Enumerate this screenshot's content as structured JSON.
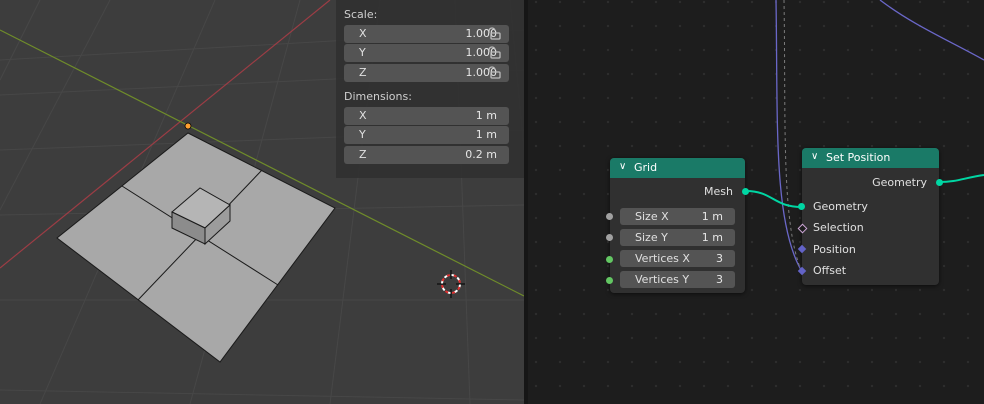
{
  "viewport": {
    "n_panel": {
      "scale_label": "Scale:",
      "scale": [
        {
          "axis": "X",
          "value": "1.000"
        },
        {
          "axis": "Y",
          "value": "1.000"
        },
        {
          "axis": "Z",
          "value": "1.000"
        }
      ],
      "dimensions_label": "Dimensions:",
      "dimensions": [
        {
          "axis": "X",
          "value": "1 m"
        },
        {
          "axis": "Y",
          "value": "1 m"
        },
        {
          "axis": "Z",
          "value": "0.2 m"
        }
      ]
    },
    "colors": {
      "background": "#3d3d3d",
      "x_axis": "#9c3d45",
      "y_axis": "#6f8c2a",
      "mesh": "#a8a8a8"
    }
  },
  "node_editor": {
    "grid_node": {
      "title": "Grid",
      "output": "Mesh",
      "inputs": [
        {
          "label": "Size X",
          "value": "1 m"
        },
        {
          "label": "Size Y",
          "value": "1 m"
        },
        {
          "label": "Vertices X",
          "value": "3"
        },
        {
          "label": "Vertices Y",
          "value": "3"
        }
      ]
    },
    "set_position_node": {
      "title": "Set Position",
      "output": "Geometry",
      "inputs": [
        "Geometry",
        "Selection",
        "Position",
        "Offset"
      ]
    },
    "colors": {
      "header": "#1a7a67",
      "geometry_socket": "#00d6a3",
      "vector_socket": "#6363c7",
      "int_socket": "#63c763"
    }
  }
}
